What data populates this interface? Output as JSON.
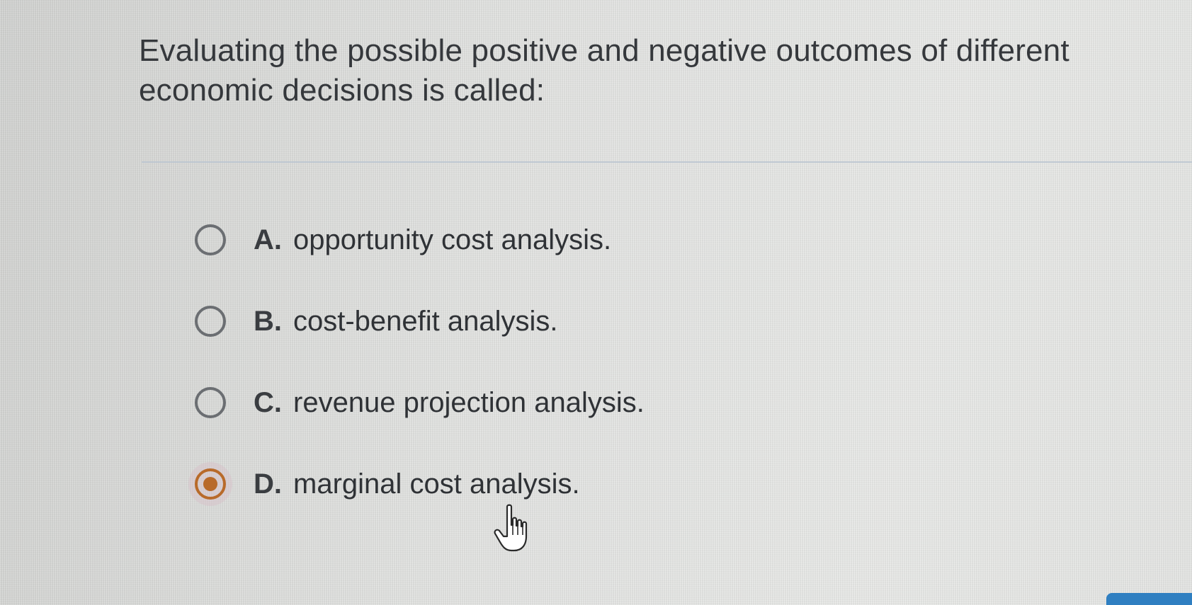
{
  "question": {
    "text": "Evaluating the possible positive and negative outcomes of different economic decisions is called:"
  },
  "options": [
    {
      "letter": "A.",
      "text": "opportunity cost analysis.",
      "selected": false
    },
    {
      "letter": "B.",
      "text": "cost-benefit analysis.",
      "selected": false
    },
    {
      "letter": "C.",
      "text": "revenue projection analysis.",
      "selected": false
    },
    {
      "letter": "D.",
      "text": "marginal cost analysis.",
      "selected": true
    }
  ],
  "colors": {
    "selected_accent": "#b86a2a",
    "radio_border": "#6b6e72",
    "divider": "#b8c3cf",
    "corner_button": "#2f7fc1"
  },
  "icons": {
    "cursor": "hand-pointer-icon"
  }
}
